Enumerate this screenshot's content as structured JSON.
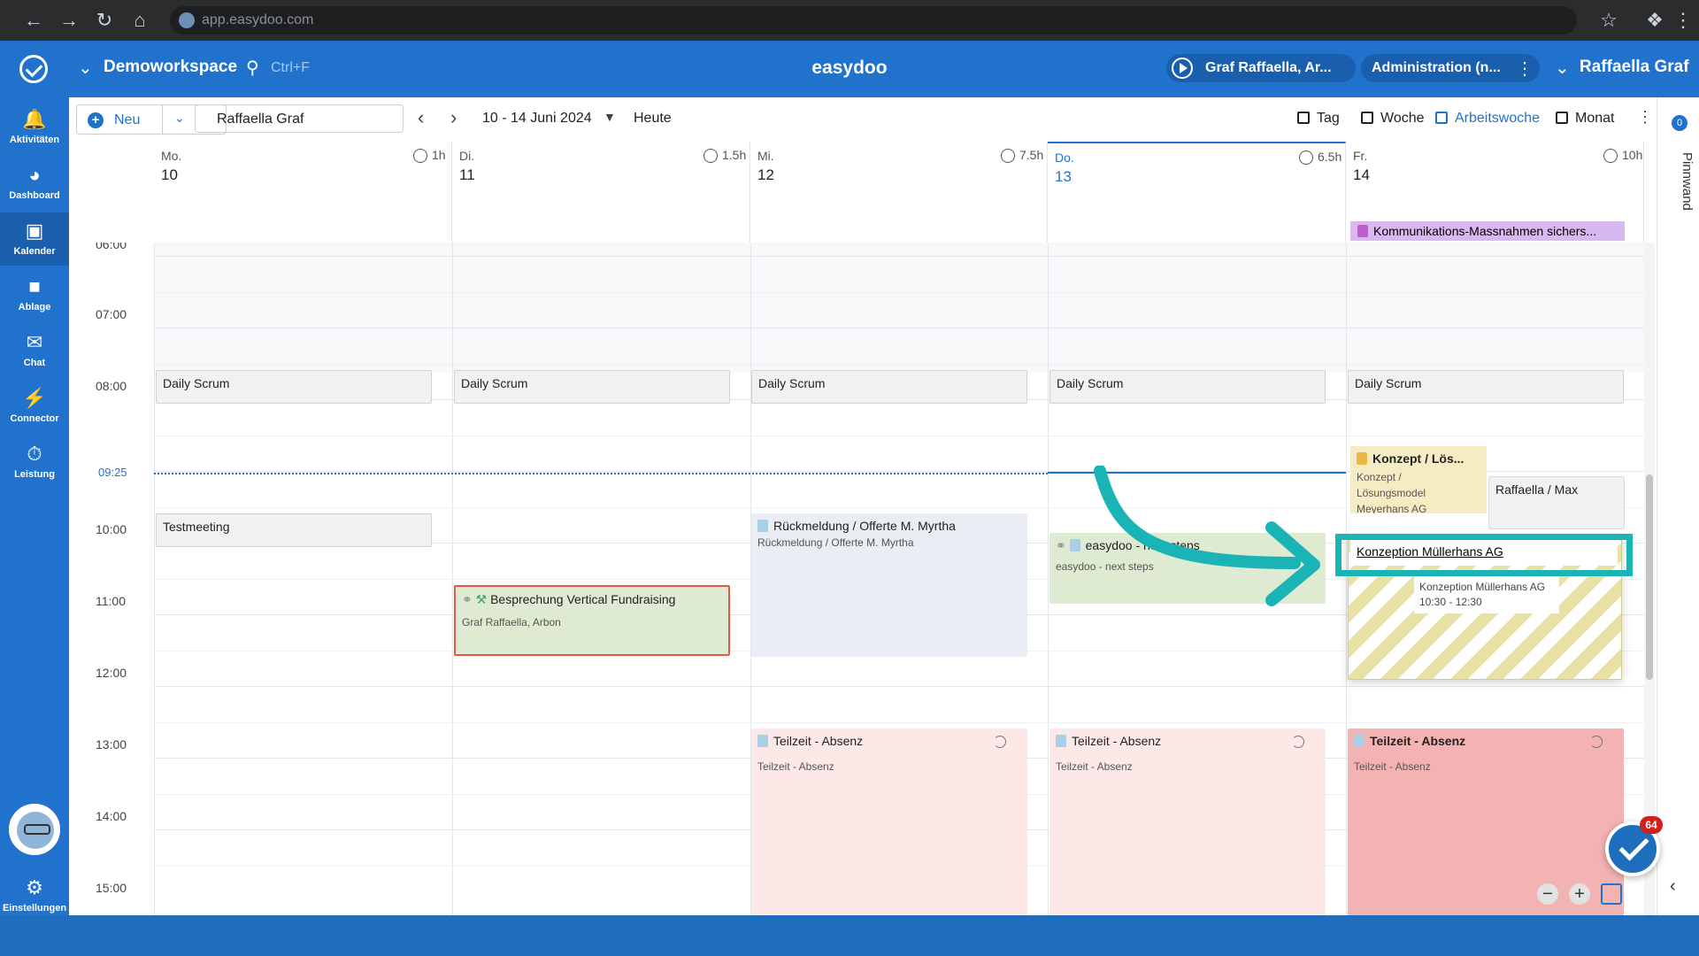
{
  "browser": {
    "url": "app.easydoo.com"
  },
  "header": {
    "workspace": "Demoworkspace",
    "search_hint": "Ctrl+F",
    "app_title": "easydoo",
    "timer_label": "Graf Raffaella, Ar...",
    "admin_label": "Administration (n...",
    "user_name": "Raffaella Graf"
  },
  "sidebar": {
    "items": [
      {
        "label": "Aktivitäten",
        "icon": "bell-icon"
      },
      {
        "label": "Dashboard",
        "icon": "gauge-icon"
      },
      {
        "label": "Kalender",
        "icon": "calendar-icon"
      },
      {
        "label": "Ablage",
        "icon": "folder-icon"
      },
      {
        "label": "Chat",
        "icon": "chat-icon"
      },
      {
        "label": "Connector",
        "icon": "plug-icon"
      },
      {
        "label": "Leistung",
        "icon": "stopwatch-icon"
      }
    ],
    "settings_label": "Einstellungen"
  },
  "toolbar": {
    "new_label": "Neu",
    "person": "Raffaella Graf",
    "date_range": "10 - 14 Juni 2024",
    "today": "Heute",
    "views": [
      "Tag",
      "Woche",
      "Arbeitswoche",
      "Monat"
    ],
    "active_view": "Arbeitswoche"
  },
  "days": [
    {
      "name": "Mo.",
      "num": "10",
      "hours": "1h"
    },
    {
      "name": "Di.",
      "num": "11",
      "hours": "1.5h"
    },
    {
      "name": "Mi.",
      "num": "12",
      "hours": "7.5h"
    },
    {
      "name": "Do.",
      "num": "13",
      "hours": "6.5h",
      "today": true
    },
    {
      "name": "Fr.",
      "num": "14",
      "hours": "10h"
    }
  ],
  "hours": [
    "06:00",
    "07:00",
    "08:00",
    "09:00",
    "10:00",
    "11:00",
    "12:00",
    "13:00",
    "14:00",
    "15:00"
  ],
  "now_label": "09:25",
  "allday_event": "Kommunikations-Massnahmen sichers...",
  "events": {
    "daily_scrum": "Daily Scrum",
    "testmeeting": "Testmeeting",
    "besprechung": {
      "title": "Besprechung Vertical Fundraising",
      "sub": "Graf Raffaella, Arbon"
    },
    "rueckmeldung": {
      "title": "Rückmeldung / Offerte M. Myrtha",
      "sub": "Rückmeldung / Offerte M. Myrtha"
    },
    "easydoo_next": {
      "title": "easydoo - next steps",
      "sub": "easydoo - next steps"
    },
    "konzept": {
      "title": "Konzept / Lös...",
      "sub1": "Konzept /",
      "sub2": "Lösungsmodel",
      "sub3": "Meyerhans AG"
    },
    "raffaella_max": "Raffaella / Max",
    "drag_card": {
      "title": "Konzeption Müllerhans AG",
      "tooltip_title": "Konzeption Müllerhans AG",
      "tooltip_time": "10:30 - 12:30"
    },
    "absence": {
      "title": "Teilzeit - Absenz",
      "sub": "Teilzeit - Absenz"
    }
  },
  "right_rail": {
    "badge": "0",
    "label": "Pinnwand"
  },
  "fab_badge": "64",
  "colors": {
    "brand": "#2172cd",
    "highlight": "#1ab3b6",
    "absence": "#fde8e8",
    "absence_strong": "#f3b3b3",
    "meeting": "#dfead3",
    "allday": "#d7b8ef"
  }
}
